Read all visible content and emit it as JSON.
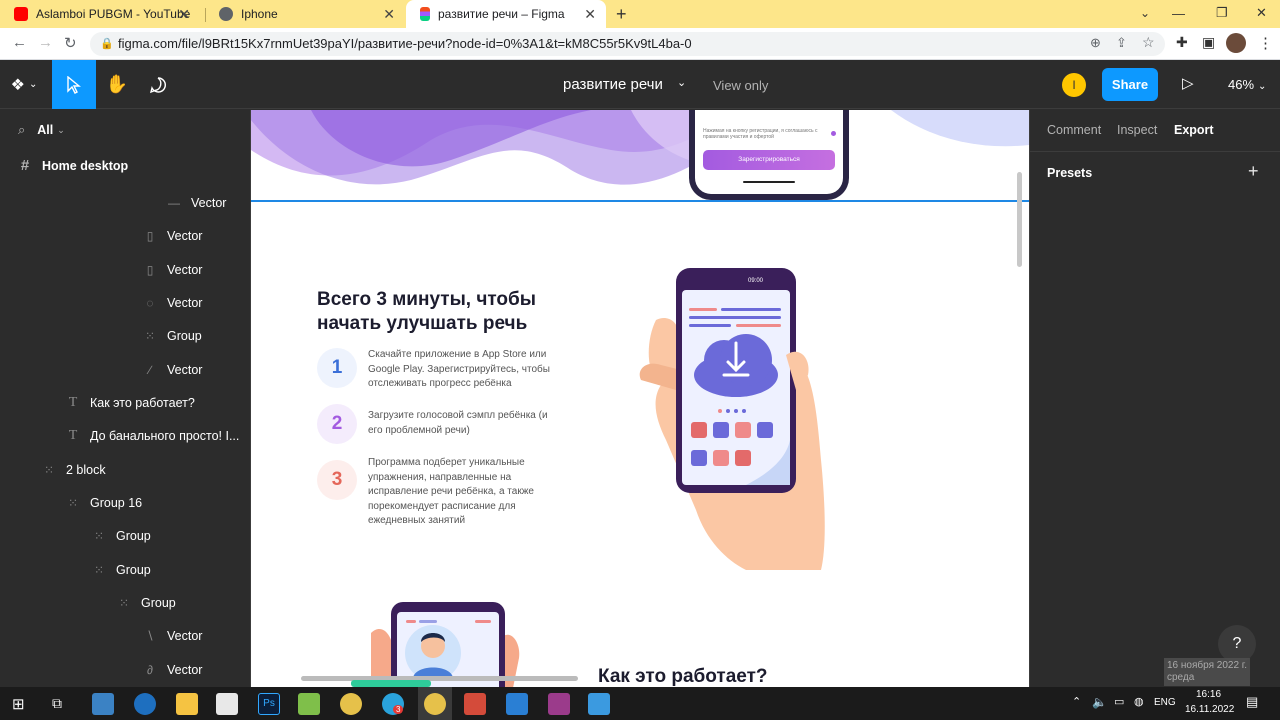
{
  "browser": {
    "tabs": [
      {
        "title": "Aslamboi PUBGM - YouTube",
        "favicon": "youtube-icon"
      },
      {
        "title": "Iphone",
        "favicon": "globe-icon"
      },
      {
        "title": "развитие речи – Figma",
        "favicon": "figma-icon"
      }
    ],
    "new_tab": "+",
    "url": "figma.com/file/l9BRt15Kx7rnmUet39paYI/развитие-речи?node-id=0%3A1&t=kM8C55r5Kv9tL4ba-0"
  },
  "figma": {
    "file_name": "развитие речи",
    "view_only": "View only",
    "avatar_letter": "I",
    "share": "Share",
    "zoom": "46%"
  },
  "layers": {
    "filter": "All",
    "page": "Home desktop",
    "items": [
      {
        "label": "Vector",
        "icon": "line-icon"
      },
      {
        "label": "Vector",
        "icon": "vector-icon"
      },
      {
        "label": "Vector",
        "icon": "vector-icon"
      },
      {
        "label": "Vector",
        "icon": "vector-icon"
      },
      {
        "label": "Group",
        "icon": "group-icon"
      },
      {
        "label": "Vector",
        "icon": "vector-icon"
      },
      {
        "label": "Как это работает?",
        "icon": "text-icon"
      },
      {
        "label": "До банального просто! I...",
        "icon": "text-icon"
      },
      {
        "label": "2 block",
        "icon": "frame-icon"
      },
      {
        "label": "Group 16",
        "icon": "group-icon"
      },
      {
        "label": "Group",
        "icon": "group-icon"
      },
      {
        "label": "Group",
        "icon": "group-icon"
      },
      {
        "label": "Group",
        "icon": "group-icon"
      },
      {
        "label": "Vector",
        "icon": "vector-icon"
      },
      {
        "label": "Vector",
        "icon": "vector-icon"
      }
    ]
  },
  "right_panel": {
    "tabs": [
      "Comment",
      "Inspect",
      "Export"
    ],
    "active_tab": "Export",
    "presets": "Presets",
    "add": "+"
  },
  "canvas": {
    "top_phone_small_text": "Нажимая на кнопку регистрации, я соглашаюсь с правилами участия и офертой",
    "register_button": "Зарегистрироваться",
    "heading": "Всего 3 минуты, чтобы начать улучшать речь",
    "steps": [
      {
        "num": "1",
        "text": "Скачайте приложение в App Store или Google Play. Зарегистрируйтесь, чтобы отслеживать прогресс ребёнка",
        "color": "#3b6fd8",
        "bg": "#eef3fd"
      },
      {
        "num": "2",
        "text": "Загрузите голосовой сэмпл ребёнка (и его проблемной речи)",
        "color": "#a35be0",
        "bg": "#f4ecfc"
      },
      {
        "num": "3",
        "text": "Программа подберет уникальные упражнения, направленные на исправление речи ребёнка, а также порекомендует расписание для ежедневных занятий",
        "color": "#e4675a",
        "bg": "#fdeeec"
      }
    ],
    "phone_time": "09:00",
    "bottom_heading": "Как это работает?"
  },
  "help": "?",
  "taskbar": {
    "lang": "ENG",
    "time": "16:16",
    "date": "16.11.2022",
    "tooltip_date": "16 ноября 2022 г.",
    "tooltip_day": "среда",
    "notification_badge": "3"
  },
  "colors": {
    "accent": "#0d99ff",
    "tabbar": "#fde68a",
    "dark_panel": "#2c2c2c"
  }
}
